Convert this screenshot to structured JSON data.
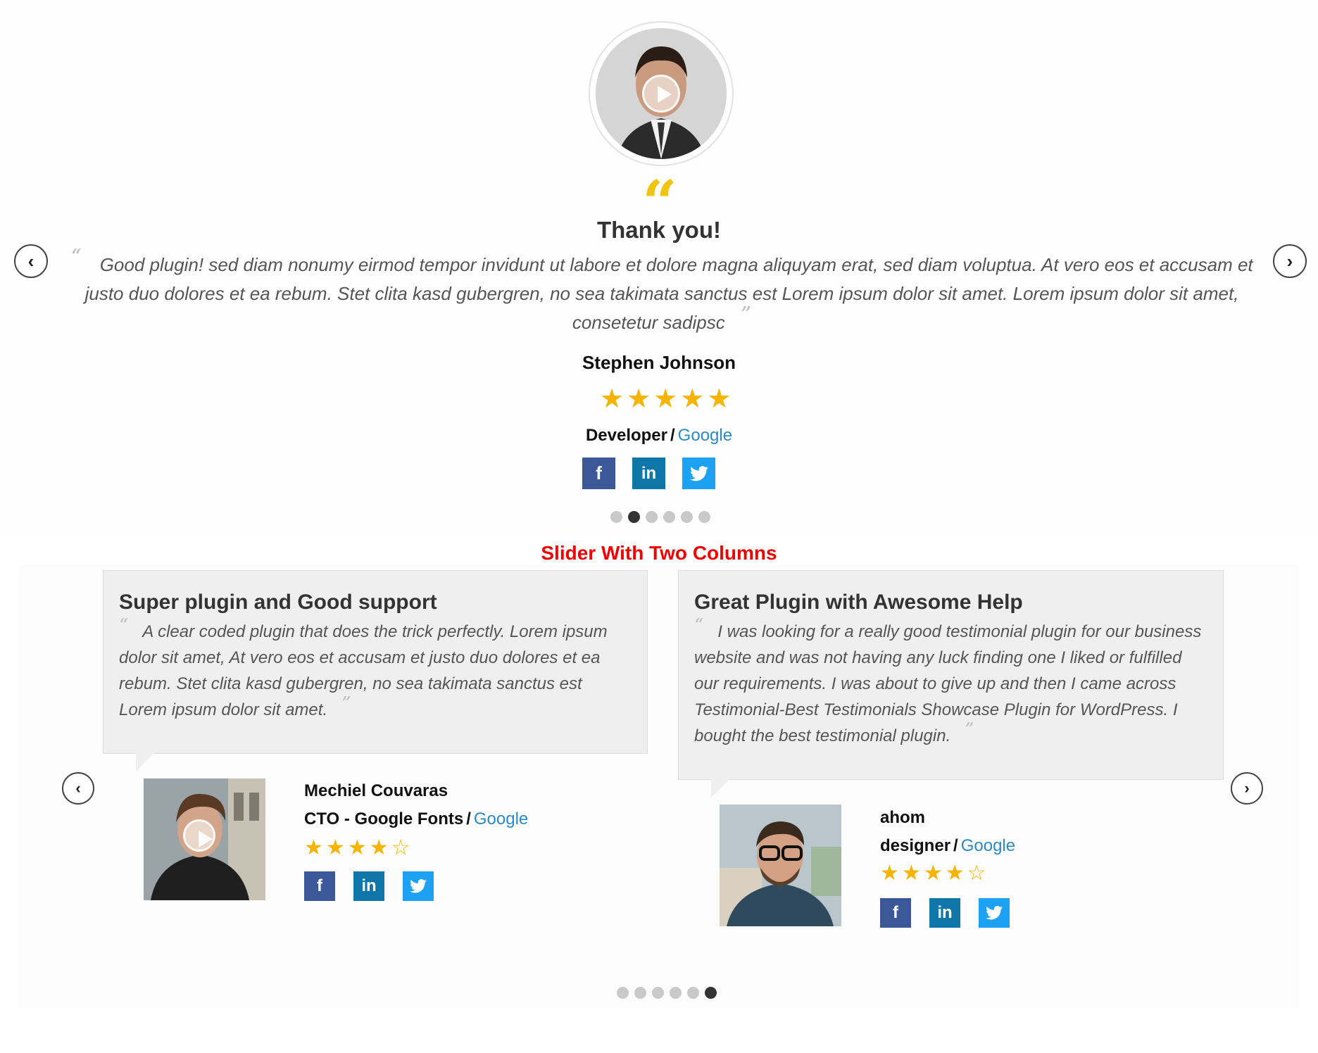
{
  "top": {
    "title": "Thank you!",
    "quote_open": "“",
    "text": "Good plugin! sed diam nonumy eirmod tempor invidunt ut labore et dolore magna aliquyam erat, sed diam voluptua. At vero eos et accusam et justo duo dolores et ea rebum. Stet clita kasd gubergren, no sea takimata sanctus est Lorem ipsum dolor sit amet. Lorem ipsum dolor sit amet, consetetur sadipsc",
    "quote_close": "”",
    "name": "Stephen Johnson",
    "rating": 5,
    "job_title": "Developer",
    "separator": "/",
    "company": "Google",
    "prev_icon": "‹",
    "next_icon": "›",
    "dots_count": 6,
    "active_dot": 1,
    "socials": {
      "facebook": "f",
      "linkedin": "in",
      "twitter": "🐦"
    }
  },
  "section_title": "Slider With Two Columns",
  "two_columns": {
    "prev_icon": "‹",
    "next_icon": "›",
    "dots_count": 6,
    "active_dot": 5,
    "items": [
      {
        "card_title": "Super plugin and Good support",
        "text": "A clear coded plugin that does the trick perfectly. Lorem ipsum dolor sit amet, At vero eos et accusam et justo duo dolores et ea rebum. Stet clita kasd gubergren, no sea takimata sanctus est Lorem ipsum dolor sit amet.",
        "name": "Mechiel Couvaras",
        "job_title": "CTO - Google Fonts",
        "separator": "/",
        "company": "Google",
        "rating": 4
      },
      {
        "card_title": "Great Plugin with Awesome Help",
        "text": "I was looking for a really good testimonial plugin for our business website and was not having any luck finding one I liked or fulfilled our requirements. I was about to give up and then I came across Testimonial-Best Testimonials Showcase Plugin for WordPress. I bought the best testimonial plugin.",
        "name": "ahom",
        "job_title": "designer",
        "separator": "/",
        "company": "Google",
        "rating": 4
      }
    ]
  },
  "colors": {
    "accent_star": "#f5b400",
    "quote_mark": "#f1c40f",
    "link": "#2b8ac6",
    "section_title": "#f00000",
    "facebook": "#3b5998",
    "linkedin": "#0e76a8",
    "twitter": "#1da1f2"
  }
}
